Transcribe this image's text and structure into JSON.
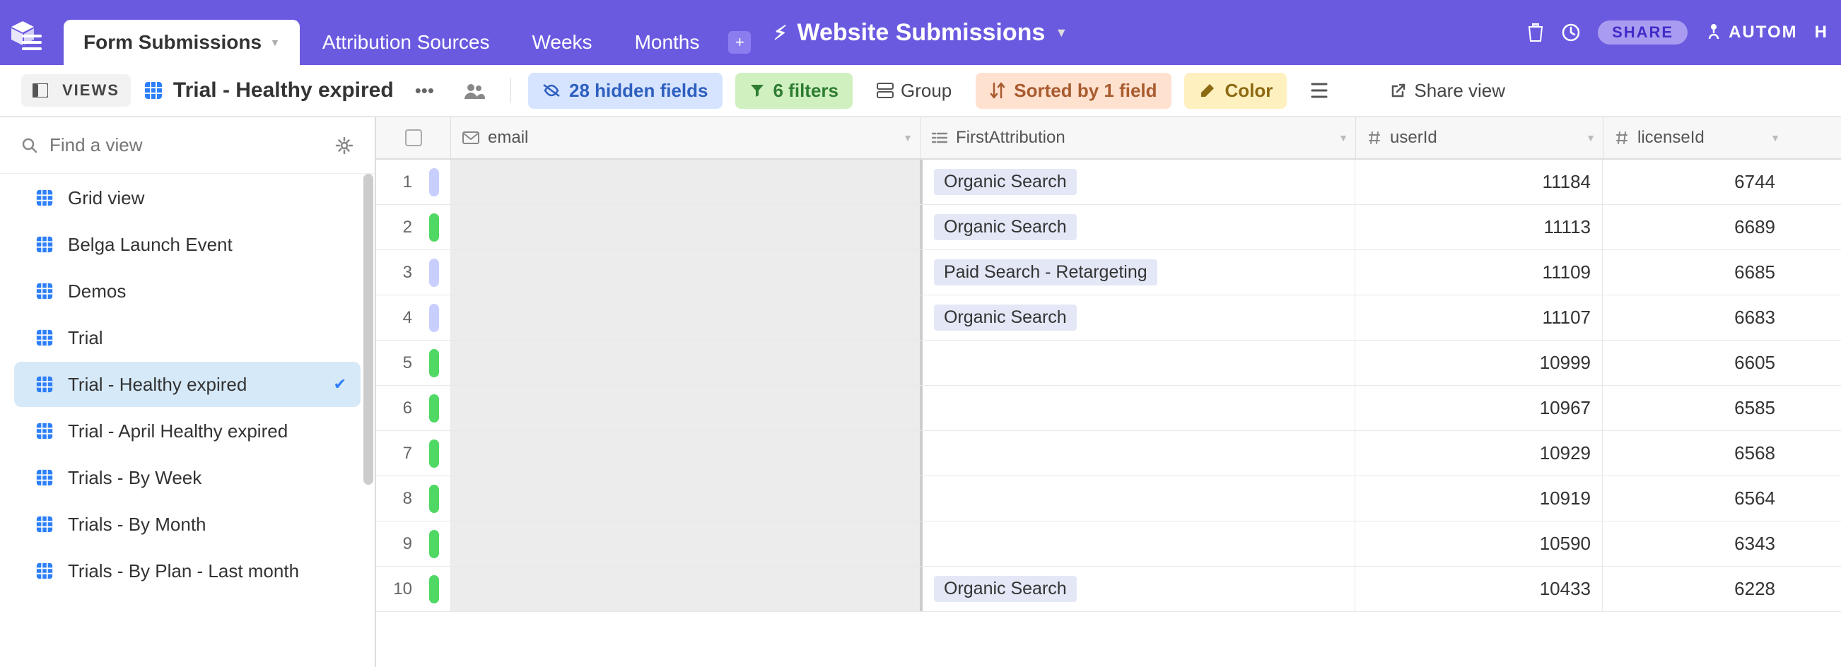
{
  "app": {
    "title": "Website Submissions",
    "right": {
      "share": "SHARE",
      "automations": "AUTOM",
      "help": "H"
    }
  },
  "tabs": [
    {
      "label": "Form Submissions",
      "active": true
    },
    {
      "label": "Attribution Sources",
      "active": false
    },
    {
      "label": "Weeks",
      "active": false
    },
    {
      "label": "Months",
      "active": false
    }
  ],
  "toolbar": {
    "views_btn": "VIEWS",
    "view_name": "Trial - Healthy expired",
    "hidden_fields": "28 hidden fields",
    "filters": "6 filters",
    "group": "Group",
    "sorted": "Sorted by 1 field",
    "color": "Color",
    "share_view": "Share view"
  },
  "sidebar": {
    "find_placeholder": "Find a view",
    "views": [
      {
        "label": "Grid view",
        "active": false
      },
      {
        "label": "Belga Launch Event",
        "active": false
      },
      {
        "label": "Demos",
        "active": false
      },
      {
        "label": "Trial",
        "active": false
      },
      {
        "label": "Trial - Healthy expired",
        "active": true
      },
      {
        "label": "Trial - April Healthy expired",
        "active": false
      },
      {
        "label": "Trials - By Week",
        "active": false
      },
      {
        "label": "Trials - By Month",
        "active": false
      },
      {
        "label": "Trials - By Plan - Last month",
        "active": false
      }
    ]
  },
  "grid": {
    "columns": {
      "email": "email",
      "attr": "FirstAttribution",
      "userid": "userId",
      "licenseid": "licenseId"
    },
    "rows": [
      {
        "n": "1",
        "color": "blue",
        "attr": "Organic Search",
        "userid": "11184",
        "licenseid": "6744"
      },
      {
        "n": "2",
        "color": "green",
        "attr": "Organic Search",
        "userid": "11113",
        "licenseid": "6689"
      },
      {
        "n": "3",
        "color": "blue",
        "attr": "Paid Search - Retargeting",
        "userid": "11109",
        "licenseid": "6685"
      },
      {
        "n": "4",
        "color": "blue",
        "attr": "Organic Search",
        "userid": "11107",
        "licenseid": "6683"
      },
      {
        "n": "5",
        "color": "green",
        "attr": "",
        "userid": "10999",
        "licenseid": "6605"
      },
      {
        "n": "6",
        "color": "green",
        "attr": "",
        "userid": "10967",
        "licenseid": "6585"
      },
      {
        "n": "7",
        "color": "green",
        "attr": "",
        "userid": "10929",
        "licenseid": "6568"
      },
      {
        "n": "8",
        "color": "green",
        "attr": "",
        "userid": "10919",
        "licenseid": "6564"
      },
      {
        "n": "9",
        "color": "green",
        "attr": "",
        "userid": "10590",
        "licenseid": "6343"
      },
      {
        "n": "10",
        "color": "green",
        "attr": "Organic Search",
        "userid": "10433",
        "licenseid": "6228"
      }
    ]
  }
}
